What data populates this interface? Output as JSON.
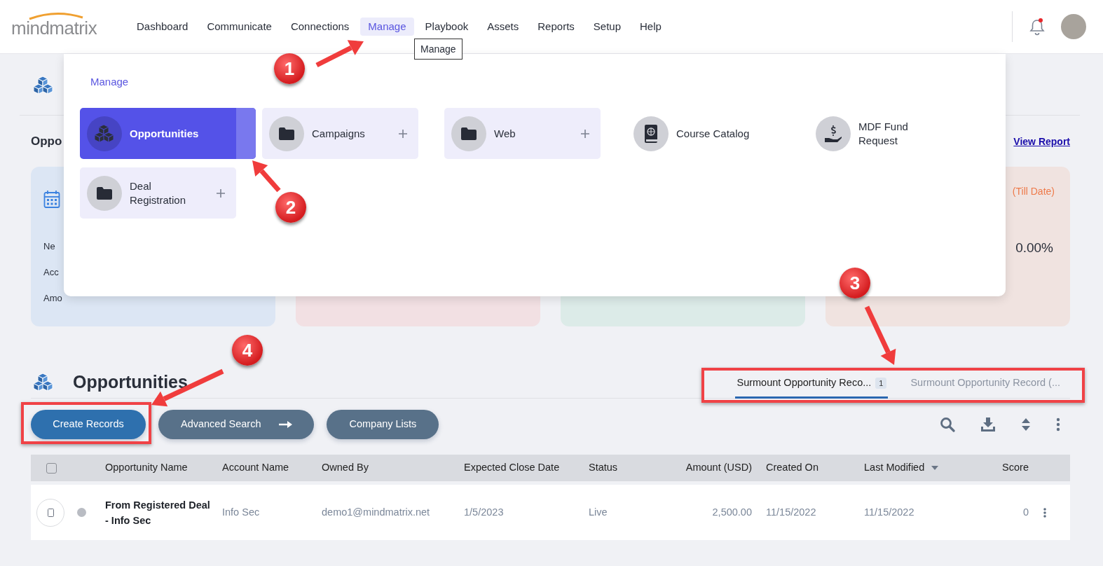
{
  "nav": {
    "logo": "mindmatrix",
    "items": [
      {
        "label": "Dashboard",
        "selected": false
      },
      {
        "label": "Communicate",
        "selected": false
      },
      {
        "label": "Connections",
        "selected": false
      },
      {
        "label": "Manage",
        "selected": true
      },
      {
        "label": "Playbook",
        "selected": false
      },
      {
        "label": "Assets",
        "selected": false
      },
      {
        "label": "Reports",
        "selected": false
      },
      {
        "label": "Setup",
        "selected": false
      },
      {
        "label": "Help",
        "selected": false
      }
    ],
    "tooltip": "Manage",
    "notifications_unread": true
  },
  "summary": {
    "heading": "Oppo",
    "view_report": "View Report",
    "cards": [
      {
        "color": "#dce6f4",
        "lines": [
          "Ne",
          "Acc",
          "Amo"
        ]
      },
      {
        "color": "#f2e0e3"
      },
      {
        "color": "#dcebe8"
      },
      {
        "color": "#f0e3e0",
        "caption": "(Till Date)",
        "value": "0.00%"
      }
    ]
  },
  "menu": {
    "title": "Manage",
    "tiles": [
      {
        "label": "Opportunities",
        "kind": "module",
        "selected": true,
        "expandable": false
      },
      {
        "label": "Campaigns",
        "kind": "folder",
        "selected": false,
        "expandable": true
      },
      {
        "label": "Web",
        "kind": "folder",
        "selected": false,
        "expandable": true
      },
      {
        "label": "Course Catalog",
        "kind": "catalog",
        "selected": false,
        "expandable": false
      },
      {
        "label": "MDF Fund Request",
        "kind": "fund",
        "selected": false,
        "expandable": false
      },
      {
        "label": "Deal Registration",
        "kind": "folder",
        "selected": false,
        "expandable": true
      }
    ]
  },
  "section": {
    "title": "Opportunities",
    "tabs": [
      {
        "label": "Surmount Opportunity Reco...",
        "count": "1",
        "selected": true
      },
      {
        "label": "Surmount Opportunity Record (...",
        "selected": false
      }
    ],
    "buttons": [
      {
        "label": "Create Records",
        "kind": "primary",
        "trailing_arrow": false
      },
      {
        "label": "Advanced Search",
        "kind": "secondary",
        "trailing_arrow": true
      },
      {
        "label": "Company Lists",
        "kind": "secondary",
        "trailing_arrow": false
      }
    ]
  },
  "table": {
    "header_checked": false,
    "columns": [
      {
        "label": "Opportunity Name",
        "sorted": false
      },
      {
        "label": "Account Name",
        "sorted": false
      },
      {
        "label": "Owned By",
        "sorted": false
      },
      {
        "label": "Expected Close Date",
        "sorted": false
      },
      {
        "label": "Status",
        "sorted": false
      },
      {
        "label": "Amount (USD)",
        "sorted": false
      },
      {
        "label": "Created On",
        "sorted": false
      },
      {
        "label": "Last Modified",
        "sorted": true
      },
      {
        "label": "Score",
        "sorted": false
      }
    ],
    "rows": [
      {
        "cells": [
          "From Registered Deal - Info Sec",
          "Info Sec",
          "demo1@mindmatrix.net",
          "1/5/2023",
          "Live",
          "2,500.00",
          "11/15/2022",
          "11/15/2022",
          "0"
        ]
      }
    ]
  },
  "annotations": [
    {
      "label": "1"
    },
    {
      "label": "2"
    },
    {
      "label": "3"
    },
    {
      "label": "4"
    }
  ]
}
